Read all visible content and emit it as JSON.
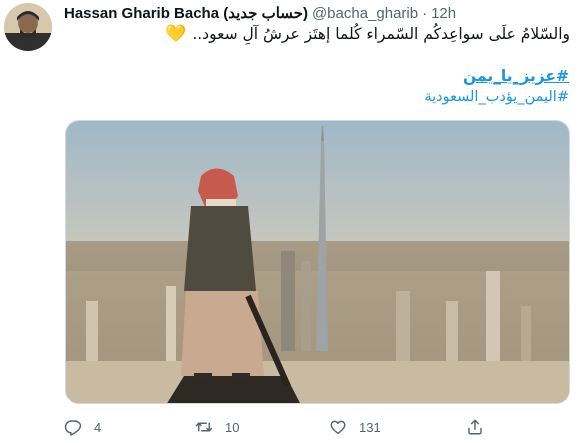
{
  "tweet": {
    "author_name": "Hassan Gharib Bacha (حساب جديد)",
    "handle": "@bacha_gharib",
    "separator": "·",
    "time": "12h",
    "text": "والسّلامُ علَى سواعِدكُم السّمراء كُلما إهتَز عرشُ آلِ سعود..",
    "heart_emoji": "💛",
    "hashtags": [
      "#عزيز_يا_يمن",
      "#اليمن_يؤدب_السعودية"
    ],
    "media_alt": "Man standing on high ledge overlooking Dubai skyline with rifle",
    "actions": {
      "reply_count": "4",
      "retweet_count": "10",
      "like_count": "131"
    },
    "icons": {
      "reply": "reply-icon",
      "retweet": "retweet-icon",
      "like": "heart-icon",
      "share": "share-icon"
    },
    "colors": {
      "link": "#1b95e0",
      "muted": "#536471",
      "text": "#0f1419"
    }
  }
}
